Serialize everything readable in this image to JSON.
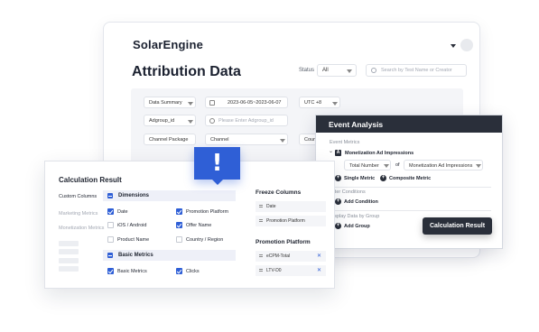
{
  "app": {
    "brand": "SolarEngine",
    "page_title": "Attribution Data"
  },
  "header": {
    "status_label": "Status",
    "status_value": "All",
    "search_placeholder": "Search by Test Name or Creator"
  },
  "filters": {
    "data_summary": "Data Summary",
    "date_range": "2023-06-05~2023-06-07",
    "timezone": "UTC +8",
    "group_by": "Adgroup_id",
    "adgroup_placeholder": "Please Enter Adgroup_id",
    "channel_package": "Channel Package",
    "channel": "Channel",
    "country_partial": "Coun"
  },
  "event_analysis": {
    "title": "Event Analysis",
    "event_metrics_label": "Event Metrics",
    "badge": "A",
    "metric_name": "Monetization Ad Impressions",
    "aggregation": "Total Number",
    "of_label": "of",
    "of_value": "Monetization Ad Impressions",
    "single_metric": "Single Metric",
    "composite_metric": "Composite Metric",
    "filter_label": "Filter Conditions",
    "add_condition": "Add Condition",
    "display_label": "Display Data by Group",
    "add_group": "Add Group",
    "calc_button": "Calculation Result"
  },
  "calc_result": {
    "title": "Calculation Result",
    "sidebar": [
      "Custom Columns",
      "Marketing Metrics",
      "Monetization Metrics"
    ],
    "dimensions": {
      "title": "Dimensions",
      "items": [
        {
          "label": "Date",
          "checked": true
        },
        {
          "label": "Promotion Platform",
          "checked": true
        },
        {
          "label": "iOS / Android",
          "checked": false
        },
        {
          "label": "Offer Name",
          "checked": true
        },
        {
          "label": "Product Name",
          "checked": false
        },
        {
          "label": "Country / Region",
          "checked": false
        }
      ]
    },
    "basic_metrics": {
      "title": "Basic Metrics",
      "items": [
        {
          "label": "Basic Metrics",
          "checked": true
        },
        {
          "label": "Clicks",
          "checked": true
        }
      ]
    },
    "freeze_title": "Freeze Columns",
    "freeze_items": [
      "Date",
      "Promotion Platform"
    ],
    "platform_title": "Promotion Platform",
    "platform_items": [
      "eCPM-Total",
      "LTV-D0"
    ]
  },
  "alert": {
    "symbol": "!"
  },
  "colors": {
    "accent": "#2f5fd6",
    "dark": "#2a2f3a"
  }
}
